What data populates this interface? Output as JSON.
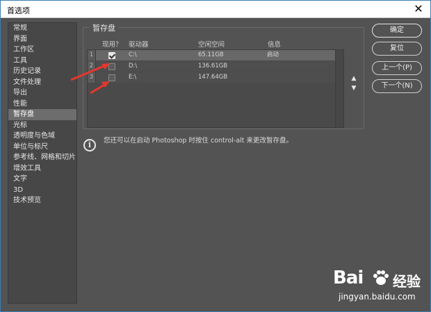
{
  "window": {
    "title": "首选项",
    "close_glyph": "✕"
  },
  "sidebar": {
    "items": [
      {
        "label": "常规",
        "active": false
      },
      {
        "label": "界面",
        "active": false
      },
      {
        "label": "工作区",
        "active": false
      },
      {
        "label": "工具",
        "active": false
      },
      {
        "label": "历史记录",
        "active": false
      },
      {
        "label": "文件处理",
        "active": false
      },
      {
        "label": "导出",
        "active": false
      },
      {
        "label": "性能",
        "active": false
      },
      {
        "label": "暂存盘",
        "active": true
      },
      {
        "label": "光标",
        "active": false
      },
      {
        "label": "透明度与色域",
        "active": false
      },
      {
        "label": "单位与标尺",
        "active": false
      },
      {
        "label": "参考线、网格和切片",
        "active": false
      },
      {
        "label": "增效工具",
        "active": false
      },
      {
        "label": "文字",
        "active": false
      },
      {
        "label": "3D",
        "active": false
      },
      {
        "label": "技术预览",
        "active": false
      }
    ]
  },
  "scratch": {
    "group_title": "暂存盘",
    "headers": {
      "active": "现用？",
      "drive": "驱动器",
      "free": "空闲空间",
      "info": "信息"
    },
    "rows": [
      {
        "num": "1",
        "checked": true,
        "drive": "C:\\",
        "free": "65.11GB",
        "info": "启动"
      },
      {
        "num": "2",
        "checked": false,
        "drive": "D:\\",
        "free": "136.61GB",
        "info": ""
      },
      {
        "num": "3",
        "checked": false,
        "drive": "E:\\",
        "free": "147.64GB",
        "info": ""
      }
    ],
    "move_up": "▲",
    "move_down": "▼",
    "hint": "您还可以在启动 Photoshop 时按住 control-alt 来更改暂存盘。",
    "info_glyph": "i"
  },
  "buttons": {
    "ok": "确定",
    "reset": "复位",
    "prev": "上一个(P)",
    "next": "下一个(N)"
  },
  "colors": {
    "dialog_bg": "#535353",
    "annotation_arrow": "#e8372b"
  },
  "icons": {
    "info": "info-icon",
    "close": "close-icon",
    "checkbox": "checkbox-icon"
  },
  "watermark": {
    "brand": "Bai",
    "suffix": "经验",
    "url": "jingyan.baidu.com"
  }
}
